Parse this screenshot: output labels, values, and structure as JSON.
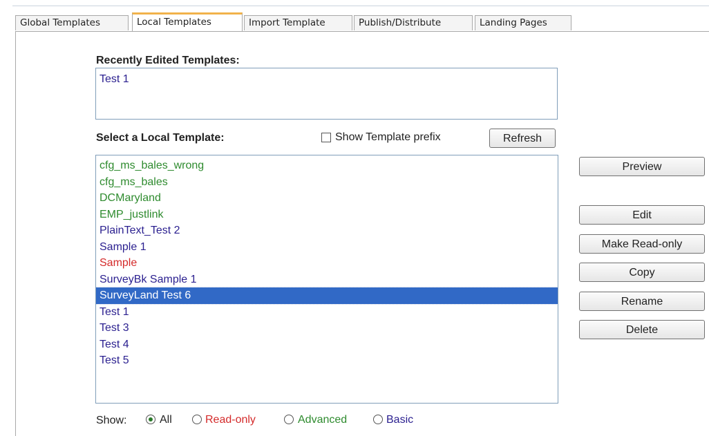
{
  "tabs": [
    {
      "label": "Global Templates",
      "active": false
    },
    {
      "label": "Local Templates",
      "active": true
    },
    {
      "label": "Import Template",
      "active": false
    },
    {
      "label": "Publish/Distribute",
      "active": false
    },
    {
      "label": "Landing Pages",
      "active": false
    }
  ],
  "recent": {
    "heading": "Recently Edited Templates:",
    "items": [
      {
        "label": "Test 1",
        "color": "#2a1f8f"
      }
    ]
  },
  "select": {
    "heading": "Select a Local Template:",
    "show_prefix_label": "Show Template prefix",
    "show_prefix_checked": false,
    "refresh_label": "Refresh",
    "items": [
      {
        "label": "cfg_ms_bales_wrong",
        "color": "#2e8b2e",
        "selected": false
      },
      {
        "label": "cfg_ms_bales",
        "color": "#2e8b2e",
        "selected": false
      },
      {
        "label": "DCMaryland",
        "color": "#2e8b2e",
        "selected": false
      },
      {
        "label": "EMP_justlink",
        "color": "#2e8b2e",
        "selected": false
      },
      {
        "label": "PlainText_Test 2",
        "color": "#2a1f8f",
        "selected": false
      },
      {
        "label": "Sample 1",
        "color": "#2a1f8f",
        "selected": false
      },
      {
        "label": "Sample",
        "color": "#d42a2a",
        "selected": false
      },
      {
        "label": "SurveyBk Sample 1",
        "color": "#2a1f8f",
        "selected": false
      },
      {
        "label": "SurveyLand Test 6",
        "color": "#2a1f8f",
        "selected": true
      },
      {
        "label": "Test 1",
        "color": "#2a1f8f",
        "selected": false
      },
      {
        "label": "Test 3",
        "color": "#2a1f8f",
        "selected": false
      },
      {
        "label": "Test 4",
        "color": "#2a1f8f",
        "selected": false
      },
      {
        "label": "Test 5",
        "color": "#2a1f8f",
        "selected": false
      }
    ]
  },
  "actions": {
    "preview": "Preview",
    "edit": "Edit",
    "make_readonly": "Make Read-only",
    "copy": "Copy",
    "rename": "Rename",
    "delete": "Delete"
  },
  "filter": {
    "label": "Show:",
    "options": [
      {
        "label": "All",
        "color": "#222222",
        "checked": true
      },
      {
        "label": "Read-only",
        "color": "#d42a2a",
        "checked": false
      },
      {
        "label": "Advanced",
        "color": "#2e8b2e",
        "checked": false
      },
      {
        "label": "Basic",
        "color": "#2a1f8f",
        "checked": false
      }
    ]
  }
}
